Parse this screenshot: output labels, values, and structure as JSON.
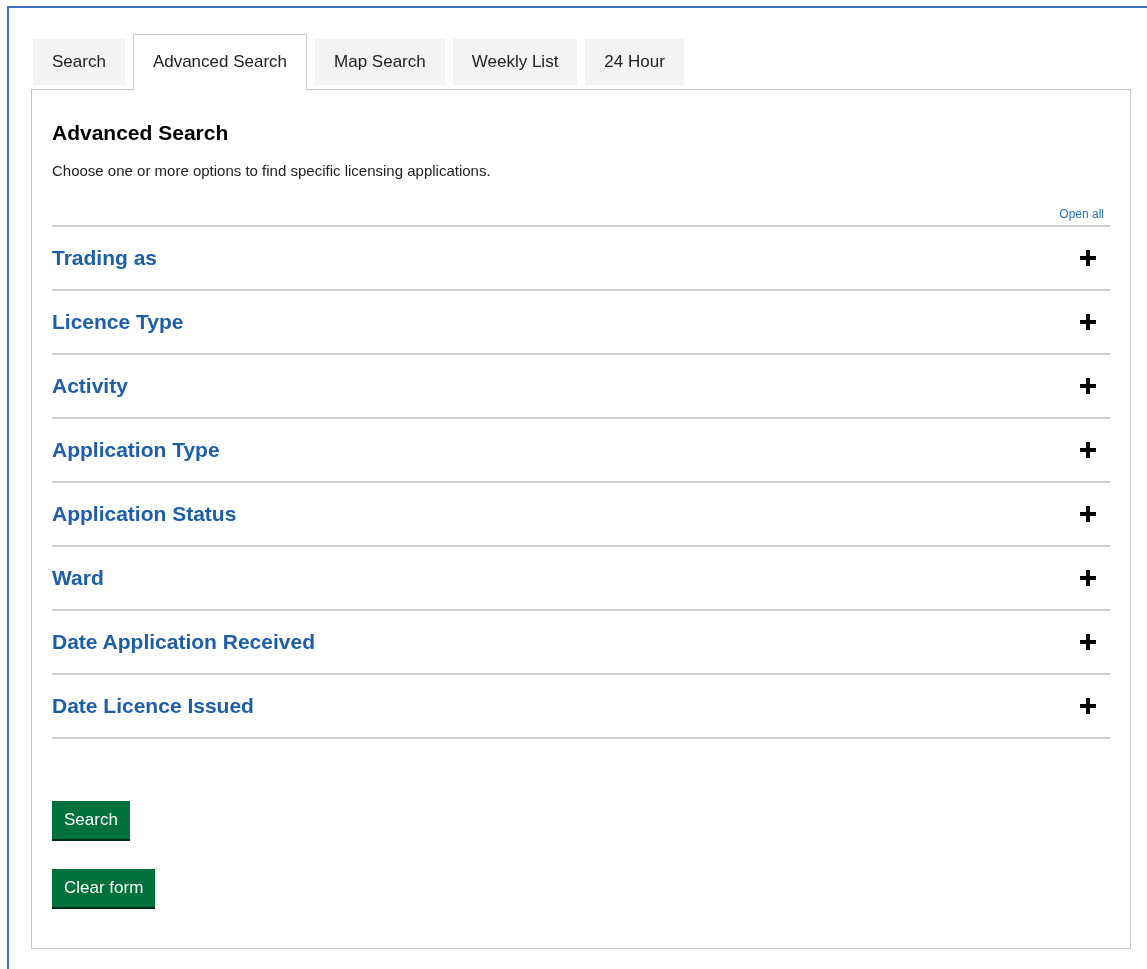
{
  "tabs": [
    {
      "label": "Search",
      "selected": false
    },
    {
      "label": "Advanced Search",
      "selected": true
    },
    {
      "label": "Map Search",
      "selected": false
    },
    {
      "label": "Weekly List",
      "selected": false
    },
    {
      "label": "24 Hour",
      "selected": false
    }
  ],
  "panel": {
    "title": "Advanced Search",
    "description": "Choose one or more options to find specific licensing applications.",
    "open_all": "Open all"
  },
  "sections": [
    {
      "label": "Trading as",
      "expanded": false
    },
    {
      "label": "Licence Type",
      "expanded": false
    },
    {
      "label": "Activity",
      "expanded": false
    },
    {
      "label": "Application Type",
      "expanded": false
    },
    {
      "label": "Application Status",
      "expanded": false
    },
    {
      "label": "Ward",
      "expanded": false
    },
    {
      "label": "Date Application Received",
      "expanded": false
    },
    {
      "label": "Date Licence Issued",
      "expanded": false
    }
  ],
  "buttons": [
    "Search",
    "Clear form"
  ]
}
